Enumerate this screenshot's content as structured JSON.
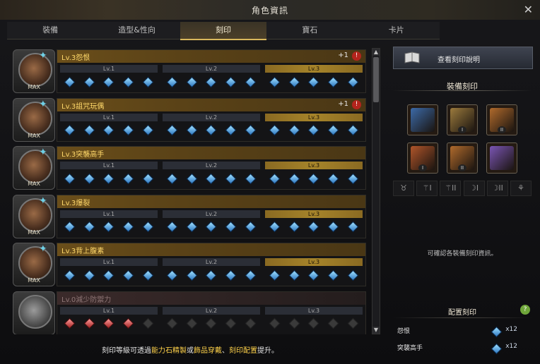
{
  "window": {
    "title": "角色資訊",
    "close": "✕"
  },
  "tabs": [
    "裝備",
    "造型&性向",
    "刻印",
    "寶石",
    "卡片"
  ],
  "active_tab": 2,
  "engravings": [
    {
      "name": "Lv.3怨恨",
      "max": "MAX",
      "badge": "+1",
      "alert": "!",
      "filled": 15,
      "style": "blue",
      "dim": false
    },
    {
      "name": "Lv.3詛咒玩偶",
      "max": "MAX",
      "badge": "+1",
      "alert": "!",
      "filled": 15,
      "style": "blue",
      "dim": false
    },
    {
      "name": "Lv.3突襲高手",
      "max": "MAX",
      "badge": "",
      "alert": "",
      "filled": 15,
      "style": "blue",
      "dim": false
    },
    {
      "name": "Lv.3爆裂",
      "max": "MAX",
      "badge": "",
      "alert": "",
      "filled": 15,
      "style": "blue",
      "dim": false
    },
    {
      "name": "Lv.3背上腹素",
      "max": "MAX",
      "badge": "",
      "alert": "",
      "filled": 15,
      "style": "blue",
      "dim": false
    },
    {
      "name": "Lv.0減少防禦力",
      "max": "",
      "badge": "",
      "alert": "",
      "filled": 4,
      "style": "red",
      "dim": true
    }
  ],
  "level_labels": [
    "Lv.1",
    "Lv.2",
    "Lv.3"
  ],
  "footer": {
    "prefix": "刻印等級可透過",
    "hl1": "能力石精製",
    "mid1": "或",
    "hl2": "飾品穿戴",
    "mid2": "、",
    "hl3": "刻印配置",
    "suffix": "提升。"
  },
  "right": {
    "guide_button": "查看刻印說明",
    "equip_title": "裝備刻印",
    "slots": [
      {
        "tag": "",
        "color": "#3c6aa8"
      },
      {
        "tag": "I",
        "color": "#9b7a3d"
      },
      {
        "tag": "II",
        "color": "#b06a2c"
      },
      {
        "tag": "I",
        "color": "#b0552a"
      },
      {
        "tag": "II",
        "color": "#b06a2c"
      },
      {
        "tag": "",
        "color": "#7a55b3"
      }
    ],
    "mini_icons": [
      "♉",
      "⚚I",
      "⚚II",
      "☽I",
      "☽II",
      "⚘"
    ],
    "hint": "可確認各裝備刻印資訊。",
    "config_title": "配置刻印",
    "help": "?",
    "config_items": [
      {
        "name": "怨恨",
        "value": "x12"
      },
      {
        "name": "突襲高手",
        "value": "x12"
      }
    ]
  },
  "colors": {
    "accent": "#d9b85c",
    "gold_label": "#ffd86a",
    "gem": "#4aa7e8"
  }
}
